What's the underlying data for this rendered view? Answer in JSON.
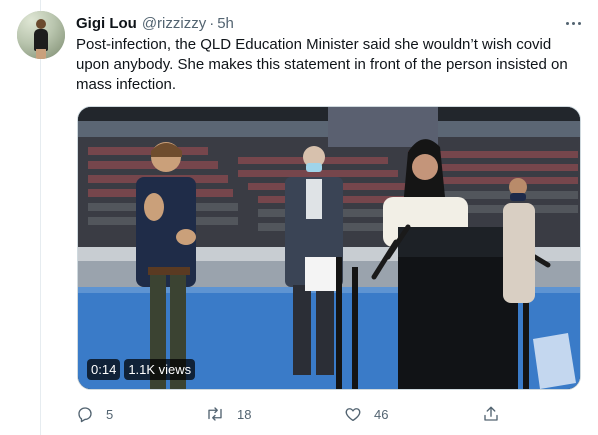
{
  "tweet": {
    "author_name": "Gigi Lou",
    "handle": "@rizzizzy",
    "separator": "·",
    "time": "5h",
    "text": "Post-infection, the QLD Education Minister said she wouldn’t wish covid upon anybody. She makes this statement in front of the person insisted on mass infection.",
    "media": {
      "duration": "0:14",
      "views": "1.1K views"
    },
    "actions": {
      "replies": "5",
      "retweets": "18",
      "likes": "46"
    }
  },
  "icons": [
    "more-icon",
    "reply-icon",
    "retweet-icon",
    "like-icon",
    "share-icon"
  ],
  "colors": {
    "text_primary": "#0f1419",
    "text_secondary": "#536471",
    "border": "#cfd9de",
    "stadium_floor": "#3a7bc8"
  }
}
